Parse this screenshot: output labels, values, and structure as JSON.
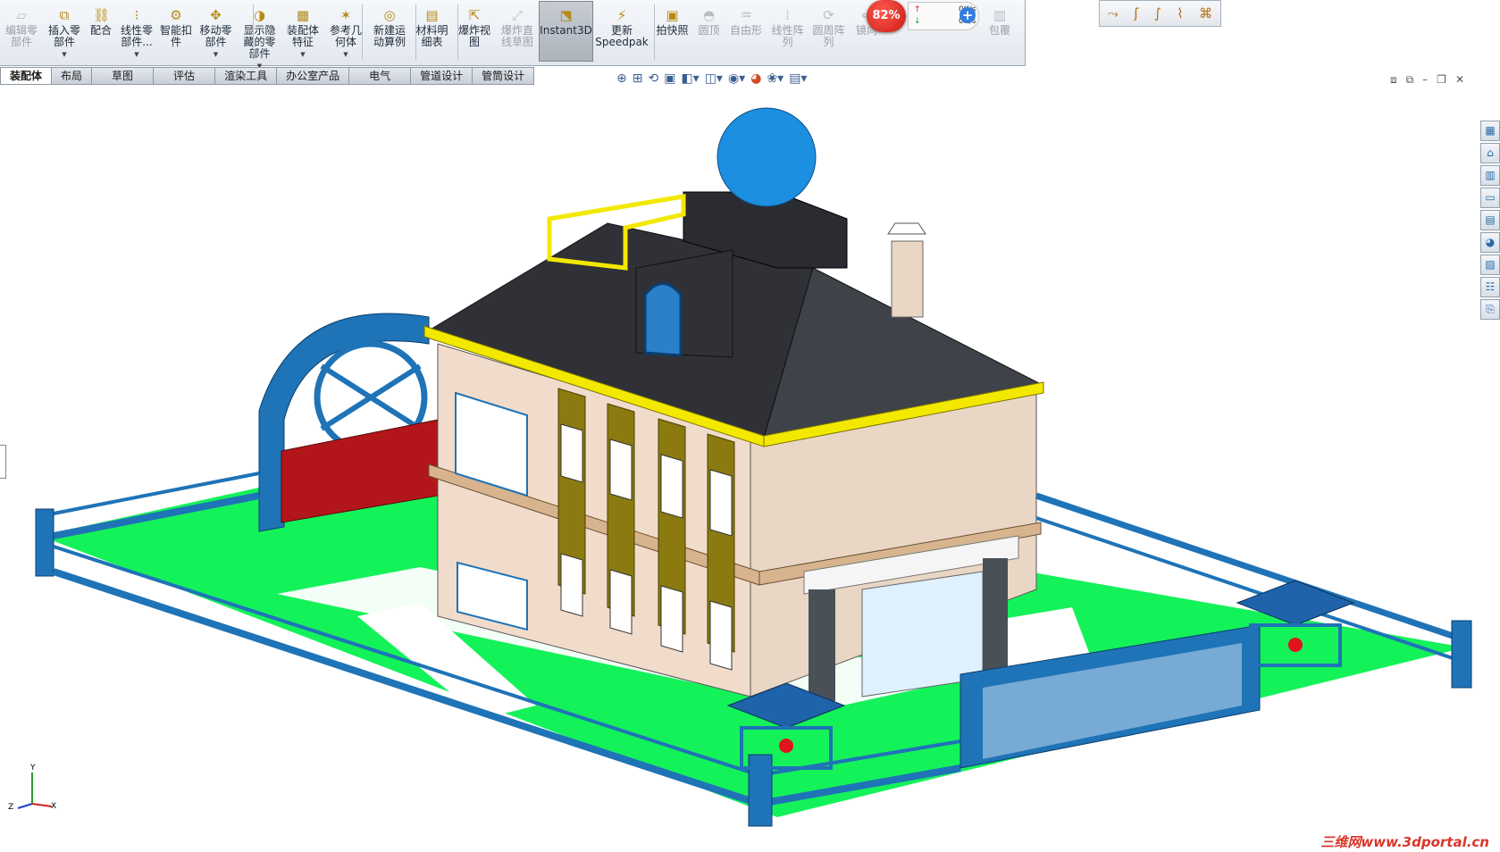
{
  "toolbar": {
    "buttons": [
      {
        "label": "编辑零\n部件",
        "icon": "edit-component-icon",
        "enabled": false
      },
      {
        "label": "插入零\n部件",
        "icon": "insert-components-icon",
        "enabled": true
      },
      {
        "label": "配合",
        "icon": "mate-icon",
        "enabled": true
      },
      {
        "label": "线性零\n部件...",
        "icon": "linear-pattern-icon",
        "enabled": true
      },
      {
        "label": "智能扣\n件",
        "icon": "smart-fasteners-icon",
        "enabled": true
      },
      {
        "label": "移动零\n部件",
        "icon": "move-component-icon",
        "enabled": true
      },
      {
        "label": "显示隐\n藏的零\n部件",
        "icon": "show-hidden-icon",
        "enabled": true
      },
      {
        "label": "装配体\n特征",
        "icon": "assembly-features-icon",
        "enabled": true
      },
      {
        "label": "参考几\n何体",
        "icon": "reference-geometry-icon",
        "enabled": true
      },
      {
        "label": "新建运\n动算例",
        "icon": "new-motion-study-icon",
        "enabled": true
      },
      {
        "label": "材料明\n细表",
        "icon": "bom-icon",
        "enabled": true
      },
      {
        "label": "爆炸视\n图",
        "icon": "exploded-view-icon",
        "enabled": true
      },
      {
        "label": "爆炸直\n线草图",
        "icon": "explode-line-sketch-icon",
        "enabled": false
      },
      {
        "label": "Instant3D",
        "icon": "instant3d-icon",
        "enabled": true,
        "active": true
      },
      {
        "label": "更新\nSpeedpak",
        "icon": "speedpak-icon",
        "enabled": true
      },
      {
        "label": "拍快照",
        "icon": "snapshot-icon",
        "enabled": true
      },
      {
        "label": "圆顶",
        "icon": "dome-icon",
        "enabled": false
      },
      {
        "label": "自由形",
        "icon": "freeform-icon",
        "enabled": false
      },
      {
        "label": "线性阵\n列",
        "icon": "linear-array-icon",
        "enabled": false
      },
      {
        "label": "圆周阵\n列",
        "icon": "circular-array-icon",
        "enabled": false
      },
      {
        "label": "镜向",
        "icon": "mirror-icon",
        "enabled": false
      },
      {
        "label": "包覆",
        "icon": "wrap-icon",
        "enabled": false
      }
    ],
    "tabs": [
      "装配体",
      "布局",
      "草图",
      "评估",
      "渲染工具",
      "办公室产品",
      "电气",
      "管道设计",
      "管筒设计"
    ]
  },
  "net_meter": {
    "percent": "82%",
    "up": "0K/s",
    "down": "0K/s",
    "plus": "+"
  },
  "watermark": "三维网www.3dportal.cn",
  "axis": {
    "x": "X",
    "y": "Y",
    "z": "Z"
  },
  "colors": {
    "roof": "#2f3137",
    "wall": "#f1dccb",
    "lawn": "#14f25a",
    "fence": "#1f73b7",
    "gate": "#b3161a",
    "trim": "#f3e800",
    "pillar": "#8a7a10",
    "dome": "#1d8fe0"
  }
}
